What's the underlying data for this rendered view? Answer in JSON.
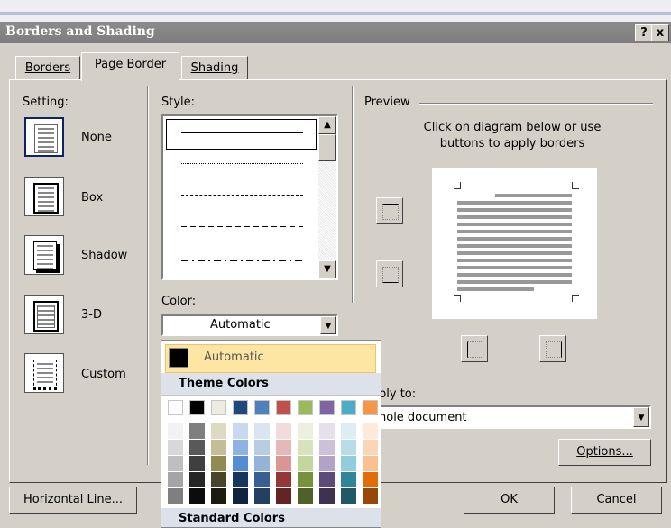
{
  "dialog": {
    "title": "Borders and Shading",
    "help_label": "?",
    "close_label": "x"
  },
  "tabs": [
    {
      "label": "Borders",
      "selected": false
    },
    {
      "label": "Page Border",
      "selected": true
    },
    {
      "label": "Shading",
      "selected": false
    }
  ],
  "setting": {
    "label": "Setting:",
    "options": [
      "None",
      "Box",
      "Shadow",
      "3-D",
      "Custom"
    ],
    "selected": "None"
  },
  "style": {
    "label": "Style:",
    "line_styles": [
      "solid",
      "dotted",
      "dashed-small",
      "dashed",
      "dash-dot"
    ]
  },
  "color": {
    "label": "Color:",
    "value": "Automatic"
  },
  "preview": {
    "label": "Preview",
    "instruction": "Click on diagram below or use buttons to apply borders"
  },
  "apply_to": {
    "label_visible": "ply to:",
    "value_visible": "hole document"
  },
  "buttons": {
    "options": "Options...",
    "horizontal_line": "Horizontal Line...",
    "ok": "OK",
    "cancel": "Cancel"
  },
  "color_popup": {
    "automatic_label": "Automatic",
    "theme_colors_header": "Theme Colors",
    "standard_colors_header": "Standard Colors",
    "theme_top_row": [
      "#ffffff",
      "#000000",
      "#eeece1",
      "#1f497d",
      "#4f81bd",
      "#c0504d",
      "#9bbb59",
      "#8064a2",
      "#4bacc6",
      "#f79646"
    ],
    "theme_shades": [
      [
        "#f2f2f2",
        "#7f7f7f",
        "#ddd9c3",
        "#c6d9f0",
        "#dbe5f1",
        "#f2dcdb",
        "#ebf1dd",
        "#e5e0ec",
        "#dbeef3",
        "#fdeada"
      ],
      [
        "#d8d8d8",
        "#595959",
        "#c4bd97",
        "#8db3e2",
        "#b8cce4",
        "#e5b9b7",
        "#d7e3bc",
        "#ccc1d9",
        "#b7dde8",
        "#fbd5b5"
      ],
      [
        "#bfbfbf",
        "#3f3f3f",
        "#938953",
        "#548dd4",
        "#95b3d7",
        "#d99694",
        "#c3d69b",
        "#b2a2c7",
        "#92cddc",
        "#fac08f"
      ],
      [
        "#a5a5a5",
        "#262626",
        "#494429",
        "#17365d",
        "#366092",
        "#953734",
        "#76923c",
        "#5f497a",
        "#31859b",
        "#e36c09"
      ],
      [
        "#7f7f7f",
        "#0c0c0c",
        "#1d1b10",
        "#0f243e",
        "#244061",
        "#632423",
        "#4f6128",
        "#3f3151",
        "#205867",
        "#974806"
      ]
    ]
  }
}
